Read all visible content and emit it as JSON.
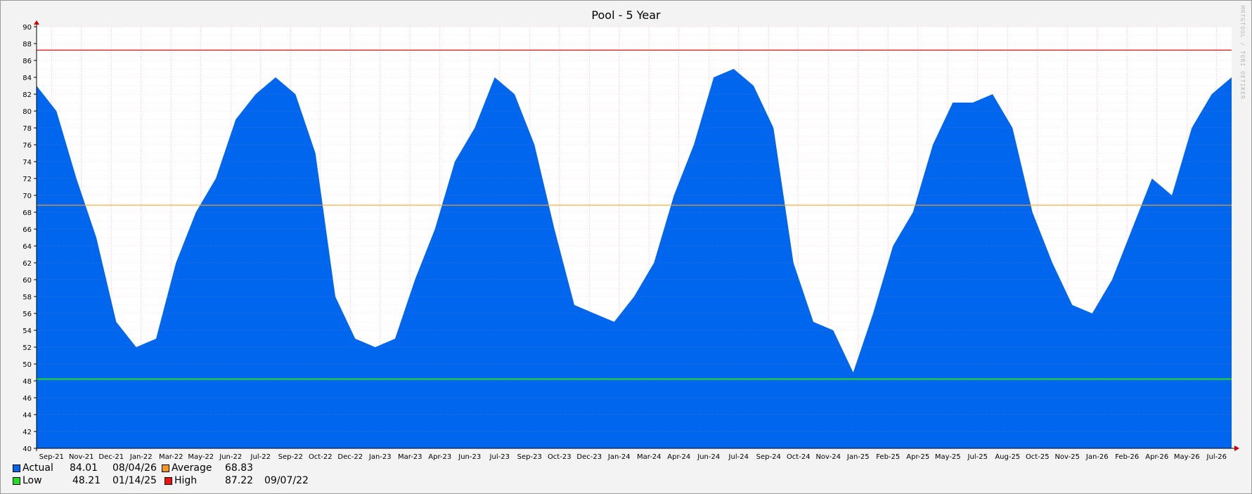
{
  "chart_data": {
    "type": "area",
    "title": "Pool - 5 Year",
    "xlabel": "",
    "ylabel": "",
    "ylim": [
      40,
      90
    ],
    "y_ticks": [
      40,
      42,
      44,
      46,
      48,
      50,
      52,
      54,
      56,
      58,
      60,
      62,
      64,
      66,
      68,
      70,
      72,
      74,
      76,
      78,
      80,
      82,
      84,
      86,
      88,
      90
    ],
    "x_tick_labels": [
      "Sep-21",
      "Nov-21",
      "Dec-21",
      "Jan-22",
      "Mar-22",
      "May-22",
      "Jun-22",
      "Jul-22",
      "Sep-22",
      "Oct-22",
      "Dec-22",
      "Jan-23",
      "Mar-23",
      "Apr-23",
      "Jun-23",
      "Jul-23",
      "Sep-23",
      "Oct-23",
      "Dec-23",
      "Jan-24",
      "Mar-24",
      "Apr-24",
      "Jun-24",
      "Jul-24",
      "Sep-24",
      "Oct-24",
      "Nov-24",
      "Jan-25",
      "Feb-25",
      "Apr-25",
      "May-25",
      "Jul-25",
      "Aug-25",
      "Oct-25",
      "Nov-25",
      "Jan-26",
      "Feb-26",
      "Apr-26",
      "May-26",
      "Jul-26"
    ],
    "grid": true,
    "legend_position": "bottom-left",
    "series": [
      {
        "name": "Actual",
        "color": "#0066ee",
        "x": [
          "08/21",
          "09/21",
          "10/21",
          "11/21",
          "12/21",
          "01/22",
          "02/22",
          "03/22",
          "04/22",
          "05/22",
          "06/22",
          "07/22",
          "08/22",
          "09/22",
          "10/22",
          "11/22",
          "12/22",
          "01/23",
          "02/23",
          "03/23",
          "04/23",
          "05/23",
          "06/23",
          "07/23",
          "08/23",
          "09/23",
          "10/23",
          "11/23",
          "12/23",
          "01/24",
          "02/24",
          "03/24",
          "04/24",
          "05/24",
          "06/24",
          "07/24",
          "08/24",
          "09/24",
          "10/24",
          "11/24",
          "12/24",
          "01/25",
          "02/25",
          "03/25",
          "04/25",
          "05/25",
          "06/25",
          "07/25",
          "08/25",
          "09/25",
          "10/25",
          "11/25",
          "12/25",
          "01/26",
          "02/26",
          "03/26",
          "04/26",
          "05/26",
          "06/26",
          "07/26",
          "08/26"
        ],
        "values": [
          83,
          80,
          72,
          65,
          55,
          52,
          53,
          62,
          68,
          72,
          79,
          82,
          84,
          82,
          75,
          58,
          53,
          52,
          53,
          60,
          66,
          74,
          78,
          84,
          82,
          76,
          66,
          57,
          56,
          55,
          58,
          62,
          70,
          76,
          84,
          85,
          83,
          78,
          62,
          55,
          54,
          49,
          56,
          64,
          68,
          76,
          81,
          81,
          82,
          78,
          68,
          62,
          57,
          56,
          60,
          66,
          72,
          70,
          78,
          82,
          84
        ]
      },
      {
        "name": "Average",
        "color": "#f5a623",
        "values": [
          68.83
        ]
      },
      {
        "name": "Low",
        "color": "#22dd22",
        "values": [
          48.21
        ]
      },
      {
        "name": "High",
        "color": "#ee1111",
        "values": [
          87.22
        ]
      }
    ]
  },
  "legend": {
    "actual": {
      "label": "Actual",
      "value": "84.01",
      "date": "08/04/26",
      "color": "#0066ee"
    },
    "average": {
      "label": "Average",
      "value": "68.83",
      "color": "#f7941d"
    },
    "low": {
      "label": "Low",
      "value": "48.21",
      "date": "01/14/25",
      "color": "#22dd22"
    },
    "high": {
      "label": "High",
      "value": "87.22",
      "date": "09/07/22",
      "color": "#ee1111"
    }
  },
  "watermark": "MRTGTOOL / TOBI OETIKER"
}
